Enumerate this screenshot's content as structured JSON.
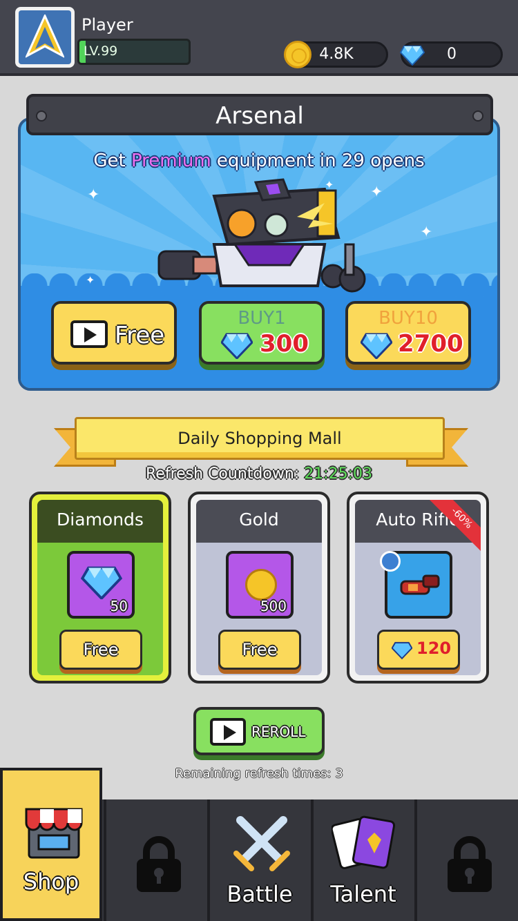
{
  "header": {
    "player_name": "Player",
    "level": "LV.99",
    "level_progress": 0.06,
    "gold": "4.8K",
    "diamonds": "0"
  },
  "arsenal": {
    "title": "Arsenal",
    "promo_prefix": "Get ",
    "promo_highlight": "Premium",
    "promo_suffix": " equipment in 29 opens",
    "free_label": "Free",
    "buy1_label": "BUY1",
    "buy1_price": "300",
    "buy10_label": "BUY10",
    "buy10_price": "2700"
  },
  "mall": {
    "title": "Daily Shopping Mall",
    "countdown_label": "Refresh Countdown: ",
    "countdown_time": "21:25:03",
    "cards": [
      {
        "title": "Diamonds",
        "qty": "50",
        "button": "Free"
      },
      {
        "title": "Gold",
        "qty": "500",
        "button": "Free"
      },
      {
        "title": "Auto Rifle",
        "price": "120",
        "discount": "-60%"
      }
    ],
    "reroll_label": "REROLL",
    "remaining": "Remaining refresh times: 3"
  },
  "nav": {
    "shop": "Shop",
    "battle": "Battle",
    "talent": "Talent"
  },
  "colors": {
    "accent_yellow": "#fbd95a",
    "accent_green": "#88e060",
    "price_red": "#e01f2b",
    "premium_pink": "#f06ef0"
  }
}
